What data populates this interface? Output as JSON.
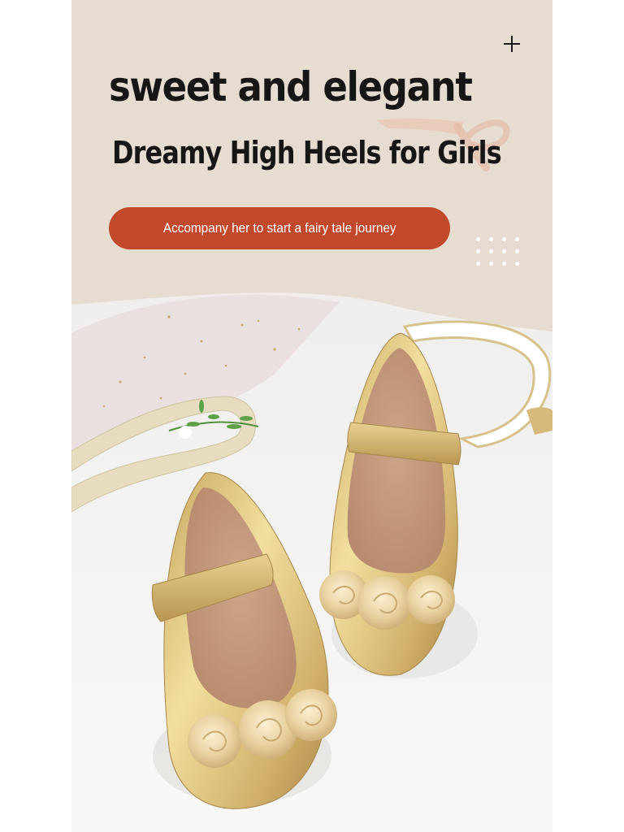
{
  "banner": {
    "headline": "sweet and elegant",
    "subheadline": "Dreamy High Heels for Girls",
    "cta_label": "Accompany her to start a fairy tale journey"
  },
  "colors": {
    "header_background": "#e6dccf",
    "cta_background": "#c2482b",
    "text": "#161616",
    "shoe_gold": "#d9bf7e"
  },
  "icons": {
    "close": "plus-icon",
    "decoration": "dot-grid"
  }
}
